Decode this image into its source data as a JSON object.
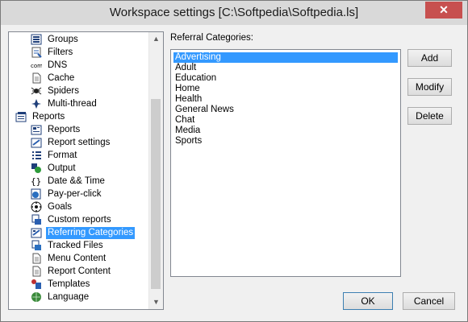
{
  "window": {
    "title": "Workspace settings [C:\\Softpedia\\Softpedia.ls]",
    "close_glyph": "✕"
  },
  "tree": {
    "items": [
      {
        "label": "Groups",
        "icon": "groups-icon",
        "level": 1
      },
      {
        "label": "Filters",
        "icon": "filters-icon",
        "level": 1
      },
      {
        "label": "DNS",
        "icon": "dns-icon",
        "level": 1,
        "icon_text": "com"
      },
      {
        "label": "Cache",
        "icon": "cache-icon",
        "level": 1
      },
      {
        "label": "Spiders",
        "icon": "spider-icon",
        "level": 1
      },
      {
        "label": "Multi-thread",
        "icon": "multi-thread-icon",
        "level": 1
      },
      {
        "label": "Reports",
        "icon": "reports-folder-icon",
        "level": 0
      },
      {
        "label": "Reports",
        "icon": "reports-icon",
        "level": 1
      },
      {
        "label": "Report settings",
        "icon": "report-settings-icon",
        "level": 1
      },
      {
        "label": "Format",
        "icon": "format-icon",
        "level": 1
      },
      {
        "label": "Output",
        "icon": "output-icon",
        "level": 1
      },
      {
        "label": "Date && Time",
        "icon": "date-time-icon",
        "level": 1,
        "icon_text": "{ }"
      },
      {
        "label": "Pay-per-click",
        "icon": "pay-per-click-icon",
        "level": 1
      },
      {
        "label": "Goals",
        "icon": "goals-icon",
        "level": 1
      },
      {
        "label": "Custom reports",
        "icon": "custom-reports-icon",
        "level": 1
      },
      {
        "label": "Referring Categories",
        "icon": "referring-categories-icon",
        "level": 1,
        "selected": true
      },
      {
        "label": "Tracked Files",
        "icon": "tracked-files-icon",
        "level": 1
      },
      {
        "label": "Menu Content",
        "icon": "menu-content-icon",
        "level": 1
      },
      {
        "label": "Report Content",
        "icon": "report-content-icon",
        "level": 1
      },
      {
        "label": "Templates",
        "icon": "templates-icon",
        "level": 1
      },
      {
        "label": "Language",
        "icon": "language-icon",
        "level": 1
      }
    ],
    "scroll_up_glyph": "▲",
    "scroll_down_glyph": "▼"
  },
  "referral": {
    "label": "Referral Categories:",
    "items": [
      "Advertising",
      "Adult",
      "Education",
      "Home",
      "Health",
      "General News",
      "Chat",
      "Media",
      "Sports"
    ],
    "selected_index": 0
  },
  "buttons": {
    "add": "Add",
    "modify": "Modify",
    "delete": "Delete",
    "ok": "OK",
    "cancel": "Cancel"
  },
  "colors": {
    "selection": "#3399ff",
    "close_button": "#c7504f"
  }
}
